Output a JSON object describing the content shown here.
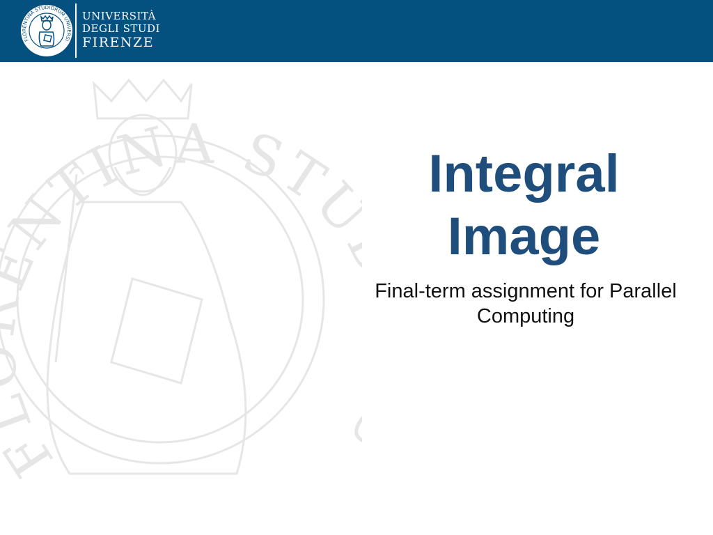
{
  "header": {
    "logo": {
      "seal_text": "FLORENTINA STUDIORUM UNIVERSITAS",
      "line1": "UNIVERSITÀ",
      "line2": "DEGLI STUDI",
      "line3": "FIRENZE"
    },
    "background_color": "#04507f"
  },
  "slide": {
    "title_line1": "Integral",
    "title_line2": "Image",
    "subtitle_line1": "Final-term assignment for Parallel",
    "subtitle_line2": "Computing",
    "title_color": "#1f4e7d"
  },
  "watermark": {
    "text": "FLORENTINA STUDIORUM UNIVERSITAS",
    "icon": "university-seal-icon"
  }
}
